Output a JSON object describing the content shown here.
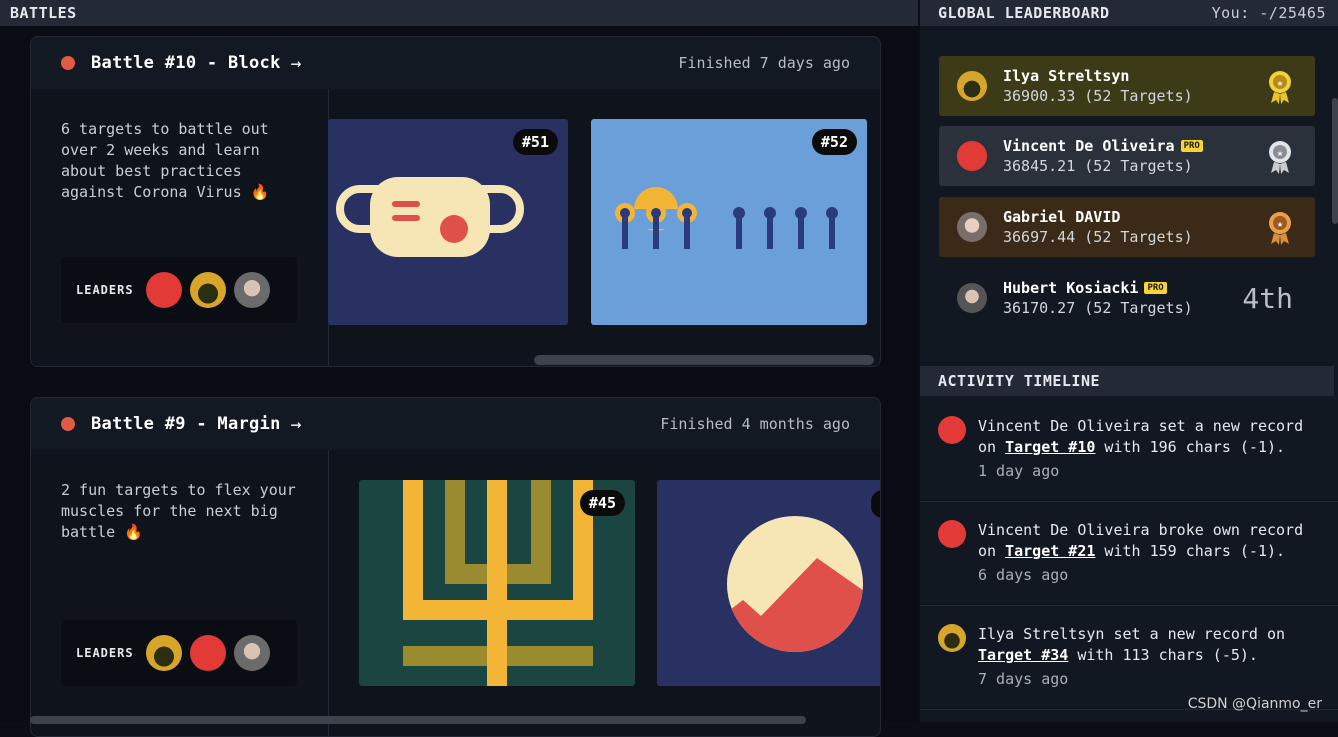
{
  "battles_header": "BATTLES",
  "battles": [
    {
      "title": "Battle #10 - Block",
      "status": "Finished 7 days ago",
      "description": "6 targets to battle out over 2 weeks and learn about best practices against Corona Virus 🔥",
      "leaders_label": "LEADERS",
      "targets": [
        "#51",
        "#52"
      ]
    },
    {
      "title": "Battle #9 - Margin",
      "status": "Finished 4 months ago",
      "description": "2 fun targets to flex your muscles for the next big battle 🔥",
      "leaders_label": "LEADERS",
      "targets": [
        "#45"
      ]
    }
  ],
  "leaderboard": {
    "header": "GLOBAL LEADERBOARD",
    "you": "You: -/25465",
    "rows": [
      {
        "name": "Ilya Streltsyn",
        "score": "36900.33 (52 Targets)",
        "pro": false,
        "medal": "gold-medal-icon"
      },
      {
        "name": "Vincent De Oliveira",
        "score": "36845.21 (52 Targets)",
        "pro": true,
        "pro_label": "PRO",
        "medal": "silver-medal-icon"
      },
      {
        "name": "Gabriel DAVID",
        "score": "36697.44 (52 Targets)",
        "pro": false,
        "medal": "bronze-medal-icon"
      },
      {
        "name": "Hubert Kosiacki",
        "score": "36170.27 (52 Targets)",
        "pro": true,
        "pro_label": "PRO",
        "rank": "4th"
      }
    ]
  },
  "activity": {
    "header": "ACTIVITY TIMELINE",
    "items": [
      {
        "pre": "Vincent De Oliveira set a new record on ",
        "link": "Target #10",
        "post": " with 196 chars (-1).",
        "time": "1 day ago"
      },
      {
        "pre": "Vincent De Oliveira broke own record on ",
        "link": "Target #21",
        "post": " with 159 chars (-1).",
        "time": "6 days ago"
      },
      {
        "pre": "Ilya Streltsyn set a new record on ",
        "link": "Target #34",
        "post": " with 113 chars (-5).",
        "time": "7 days ago"
      }
    ]
  },
  "watermark": "CSDN @Qianmo_er",
  "colors": {
    "red_dot": "#e05a45",
    "gold_row": "#3d3b17",
    "silver_row": "#2b313b",
    "bronze_row": "#3a2a17",
    "pro_badge": "#f6d434"
  }
}
